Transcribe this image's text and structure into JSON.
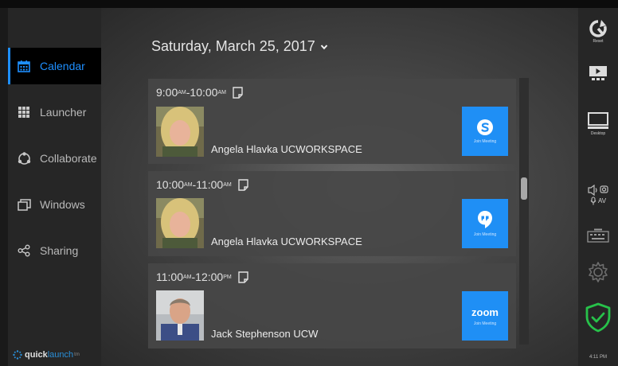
{
  "sidebar": {
    "items": [
      {
        "label": "Calendar",
        "icon": "calendar-icon",
        "active": true
      },
      {
        "label": "Launcher",
        "icon": "grid-icon",
        "active": false
      },
      {
        "label": "Collaborate",
        "icon": "collaborate-icon",
        "active": false
      },
      {
        "label": "Windows",
        "icon": "windows-icon",
        "active": false
      },
      {
        "label": "Sharing",
        "icon": "share-icon",
        "active": false
      }
    ],
    "logo": {
      "quick": "quick",
      "launch": "launch",
      "tm": "tm"
    }
  },
  "header": {
    "date": "Saturday, March 25, 2017"
  },
  "meetings": [
    {
      "start": "9:00",
      "start_ampm": "AM",
      "end": "10:00",
      "end_ampm": "AM",
      "organizer": "Angela Hlavka UCWORKSPACE",
      "service": "Skype",
      "join_label": "Join Meeting"
    },
    {
      "start": "10:00",
      "start_ampm": "AM",
      "end": "11:00",
      "end_ampm": "AM",
      "organizer": "Angela Hlavka UCWORKSPACE",
      "service": "Hangouts",
      "join_label": "Join Meeting"
    },
    {
      "start": "11:00",
      "start_ampm": "AM",
      "end": "12:00",
      "end_ampm": "PM",
      "organizer": "Jack Stephenson UCW",
      "service": "zoom",
      "join_label": "Join Meeting"
    }
  ],
  "rightbar": {
    "reset_label": "Reset",
    "desktop_label": "Desktop",
    "av_label": "AV",
    "clock": "4:11 PM"
  },
  "colors": {
    "accent": "#1e8fff",
    "join": "#1f8ff5",
    "shield": "#27c24a"
  }
}
